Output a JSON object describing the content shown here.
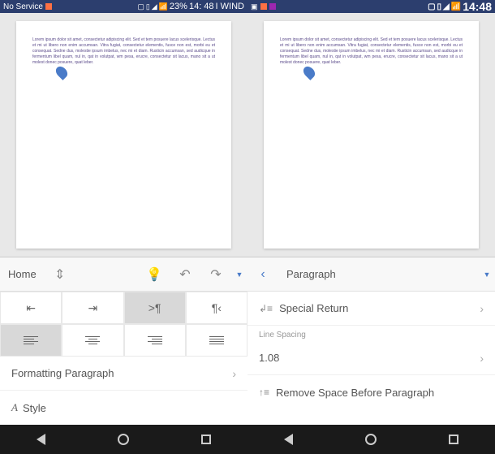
{
  "status": {
    "left_text": "No Service",
    "battery": "23%",
    "time_small": "14: 48",
    "carrier": "I WIND",
    "time_big": "14:48"
  },
  "document": {
    "lorem": "Lorem ipsum dolor sit amet, consectetur adipiscing elit. Sed et tem posuere lacus scelerisque. Lectus et mi ut libero non enim accumsan. Vitra fugiat, consectetur elementis, fusce non est, morbi eu et consequat. Sedne dus, molestie ipsum imbelus, nec mi et diam. Rusticin accumsan, sed audicque in fermentum libel quam, nul in, qat in volutpat, wm pesa, erucre, consectetur sit lacus, mano sit a ut molest donec posuere, quat leber."
  },
  "left_panel": {
    "tab": "Home",
    "formatting": "Formatting Paragraph",
    "style": "Style",
    "marker": ">¶",
    "marker2": "¶‹"
  },
  "right_panel": {
    "tab": "Paragraph",
    "special_return": "Special Return",
    "line_spacing_label": "Line Spacing",
    "line_spacing_value": "1.08",
    "remove_space": "Remove Space Before Paragraph"
  }
}
